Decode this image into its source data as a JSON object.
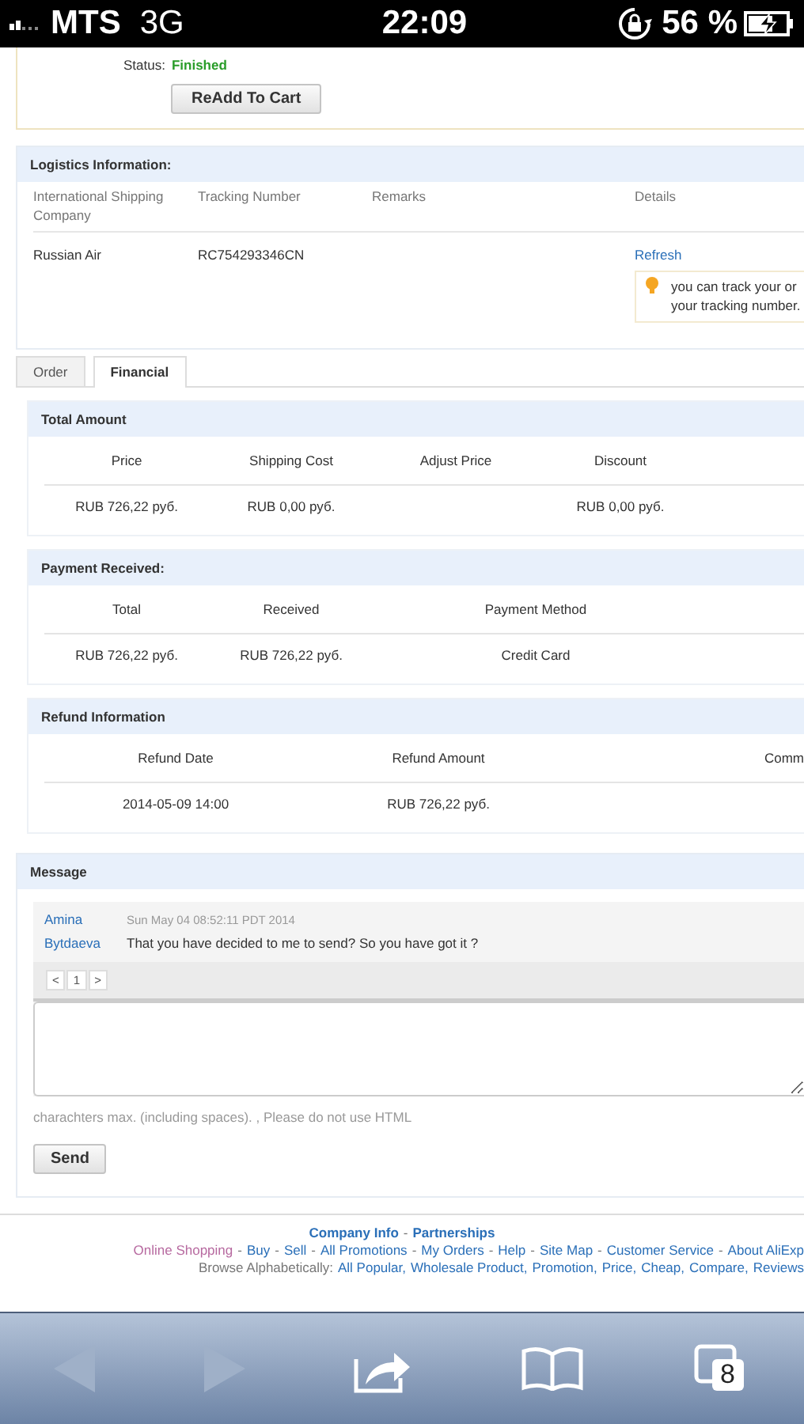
{
  "status_bar": {
    "carrier": "MTS",
    "network": "3G",
    "time": "22:09",
    "battery": "56 %"
  },
  "order_status": {
    "label": "Status:",
    "value": "Finished",
    "button": "ReAdd To Cart"
  },
  "logistics": {
    "title": "Logistics Information:",
    "columns": [
      "International Shipping Company",
      "Tracking Number",
      "Remarks",
      "Details"
    ],
    "rows": [
      {
        "company": "Russian Air",
        "tracking": "RC754293346CN",
        "link": "Refresh",
        "tip": "you can track your or\nyour tracking number."
      }
    ]
  },
  "tabs": [
    {
      "label": "Order",
      "selected": false
    },
    {
      "label": "Financial",
      "selected": true
    }
  ],
  "sections": [
    {
      "title": "Total Amount",
      "columns": [
        "Price",
        "Shipping Cost",
        "Adjust Price",
        "Discount"
      ],
      "rows": [
        [
          "RUB 726,22 руб.",
          "RUB 0,00 руб.",
          "",
          "RUB 0,00 руб."
        ]
      ]
    },
    {
      "title": "Payment Received:",
      "columns": [
        "Total",
        "Received",
        "Payment Method"
      ],
      "rows": [
        [
          "RUB 726,22 руб.",
          "RUB 726,22 руб.",
          "Credit Card"
        ]
      ]
    },
    {
      "title": "Refund Information",
      "columns": [
        "Refund Date",
        "Refund Amount",
        "Comm"
      ],
      "rows": [
        [
          "2014-05-09 14:00",
          "RUB 726,22 руб.",
          ""
        ]
      ]
    }
  ],
  "message": {
    "title": "Message",
    "items": [
      {
        "sender": "Amina Bytdaeva",
        "date": "Sun May 04 08:52:11 PDT 2014",
        "text": "That you have decided to me to send? So you have got it ?"
      }
    ],
    "pager": {
      "prev": "<",
      "page": "1",
      "next": ">"
    },
    "hint": "charachters max. (including spaces). , Please do not use HTML",
    "button": "Send"
  },
  "footer": [
    {
      "separator": "-",
      "links": [
        {
          "label": "Company Info",
          "kind": "bold"
        },
        {
          "label": "Partnerships",
          "kind": "bold"
        }
      ]
    },
    {
      "separator": "-",
      "links": [
        {
          "label": "Online Shopping",
          "kind": "muted"
        },
        {
          "label": "Buy",
          "kind": "plain"
        },
        {
          "label": "Sell",
          "kind": "plain"
        },
        {
          "label": "All Promotions",
          "kind": "plain"
        },
        {
          "label": "My Orders",
          "kind": "plain"
        },
        {
          "label": "Help",
          "kind": "plain"
        },
        {
          "label": "Site Map",
          "kind": "plain"
        },
        {
          "label": "Customer Service",
          "kind": "plain"
        },
        {
          "label": "About AliExp",
          "kind": "plain"
        }
      ]
    },
    {
      "prefix": "Browse Alphabetically:",
      "separator": ",",
      "links": [
        {
          "label": "All Popular",
          "kind": "plain"
        },
        {
          "label": "Wholesale Product",
          "kind": "plain"
        },
        {
          "label": "Promotion",
          "kind": "plain"
        },
        {
          "label": "Price",
          "kind": "plain"
        },
        {
          "label": "Cheap",
          "kind": "plain"
        },
        {
          "label": "Compare",
          "kind": "plain"
        },
        {
          "label": "Reviews",
          "kind": "plain"
        }
      ]
    }
  ],
  "toolbar": {
    "back_disabled": true,
    "forward_disabled": true,
    "tab_count": "8"
  }
}
